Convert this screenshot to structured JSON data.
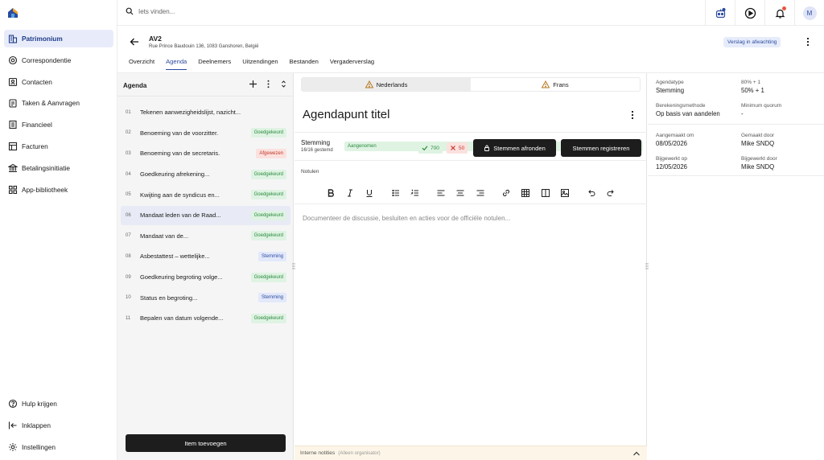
{
  "sidebar": {
    "items": [
      {
        "label": "Patrimonium",
        "icon": "building-icon",
        "active": true
      },
      {
        "label": "Correspondentie",
        "icon": "at-sign-icon"
      },
      {
        "label": "Contacten",
        "icon": "contacts-icon"
      },
      {
        "label": "Taken & Aanvragen",
        "icon": "clipboard-icon"
      },
      {
        "label": "Financieel",
        "icon": "document-icon"
      },
      {
        "label": "Facturen",
        "icon": "invoice-icon"
      },
      {
        "label": "Betalingsinitiatie",
        "icon": "bank-icon"
      },
      {
        "label": "App-bibliotheek",
        "icon": "grid-icon"
      }
    ],
    "bottom": [
      {
        "label": "Hulp krijgen",
        "icon": "help-icon"
      },
      {
        "label": "Inklappen",
        "icon": "collapse-icon"
      },
      {
        "label": "Instellingen",
        "icon": "gear-icon"
      }
    ]
  },
  "topbar": {
    "search_placeholder": "Iets vinden...",
    "avatar_initial": "M",
    "notification_color": "#e8553f"
  },
  "header": {
    "title": "AV2",
    "address": "Rue Prince Baudouin 136, 1083 Ganshoren, België",
    "status": "Verslag in afwachting",
    "tabs": [
      "Overzicht",
      "Agenda",
      "Deelnemers",
      "Uitzendingen",
      "Bestanden",
      "Vergaderverslag"
    ],
    "active_tab": "Agenda"
  },
  "agenda": {
    "title": "Agenda",
    "add_button": "Item toevoegen",
    "items": [
      {
        "num": "01",
        "label": "Tekenen aanwezigheidslijst, nazicht...",
        "badge": "",
        "type": ""
      },
      {
        "num": "02",
        "label": "Benoeming van de voorzitter.",
        "badge": "Goedgekeurd",
        "type": "green"
      },
      {
        "num": "03",
        "label": "Benoeming van de secretaris.",
        "badge": "Afgewezen",
        "type": "red"
      },
      {
        "num": "04",
        "label": "Goedkeuring afrekening...",
        "badge": "Goedgekeurd",
        "type": "green"
      },
      {
        "num": "05",
        "label": "Kwijting aan de syndicus en...",
        "badge": "Goedgekeurd",
        "type": "green"
      },
      {
        "num": "06",
        "label": "Mandaat leden van de Raad...",
        "badge": "Goedgekeurd",
        "type": "green",
        "selected": true
      },
      {
        "num": "07",
        "label": "Mandaat van de...",
        "badge": "Goedgekeurd",
        "type": "green"
      },
      {
        "num": "08",
        "label": "Asbestattest – wettelijke...",
        "badge": "Stemming",
        "type": "blue"
      },
      {
        "num": "09",
        "label": "Goedkeuring begroting volge...",
        "badge": "Goedgekeurd",
        "type": "green"
      },
      {
        "num": "10",
        "label": "Status en begroting...",
        "badge": "Stemming",
        "type": "blue"
      },
      {
        "num": "11",
        "label": "Bepalen van datum volgende...",
        "badge": "Goedgekeurd",
        "type": "green"
      }
    ]
  },
  "detail": {
    "languages": [
      "Nederlands",
      "Frans"
    ],
    "active_language": "Nederlands",
    "title": "Agendapunt titel",
    "vote_label": "Stemming",
    "vote_sub": "16/16 gestemd",
    "vote_status": "Aangenomen",
    "yes_count": "700",
    "no_count": "50",
    "close_button": "Stemmen afronden",
    "register_button": "Stemmen registreren",
    "notulen_label": "Notulen",
    "editor_placeholder": "Documenteer de discussie, besluiten en acties voor de officiële notulen...",
    "notes_label": "Interne notities",
    "notes_sub": "(Alleen organisator)"
  },
  "properties": {
    "agendatype_label": "Agendatype",
    "agendatype_value": "Stemming",
    "majority_label": "80% + 1",
    "majority_value": "50% + 1",
    "method_label": "Berekeningsmethode",
    "method_value": "Op basis van aandelen",
    "quorum_label": "Minimum quorum",
    "quorum_value": "-",
    "created_label": "Aangemaakt om",
    "created_value": "08/05/2026",
    "created_by_label": "Gemaakt door",
    "created_by_value": "Mike SNDQ",
    "updated_label": "Bijgewerkt op",
    "updated_value": "12/05/2026",
    "updated_by_label": "Bijgewerkt door",
    "updated_by_value": "Mike SNDQ"
  },
  "colors": {
    "accent": "#2c4a9e",
    "approved": "#2b8a3e",
    "rejected": "#c0392b",
    "dark_button": "#1d1d1d"
  }
}
